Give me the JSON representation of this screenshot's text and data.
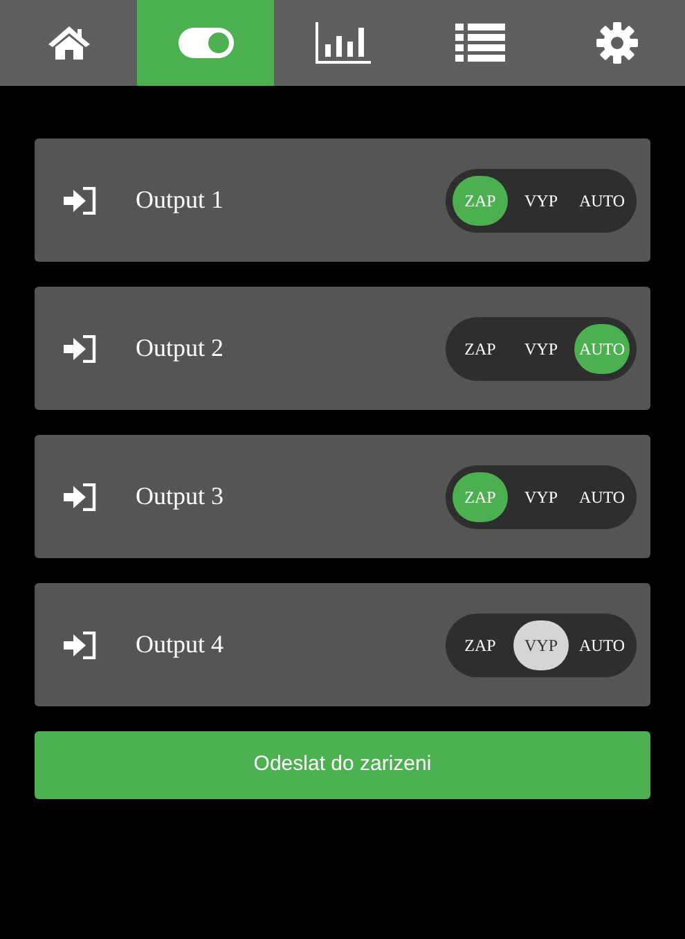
{
  "nav": {
    "tabs": [
      {
        "kind": "home",
        "selected": false
      },
      {
        "kind": "toggle",
        "selected": true
      },
      {
        "kind": "chart",
        "selected": false
      },
      {
        "kind": "list",
        "selected": false
      },
      {
        "kind": "settings",
        "selected": false
      }
    ]
  },
  "outputs": [
    {
      "name": "Output 1",
      "options": [
        {
          "label": "ZAP",
          "selected": true,
          "color": "#4caf50"
        },
        {
          "label": "VYP",
          "selected": false
        },
        {
          "label": "AUTO",
          "selected": false
        }
      ]
    },
    {
      "name": "Output 2",
      "options": [
        {
          "label": "ZAP",
          "selected": false
        },
        {
          "label": "VYP",
          "selected": false
        },
        {
          "label": "AUTO",
          "selected": true,
          "color": "#4caf50"
        }
      ]
    },
    {
      "name": "Output 3",
      "options": [
        {
          "label": "ZAP",
          "selected": true,
          "color": "#4caf50"
        },
        {
          "label": "VYP",
          "selected": false
        },
        {
          "label": "AUTO",
          "selected": false
        }
      ]
    },
    {
      "name": "Output 4",
      "options": [
        {
          "label": "ZAP",
          "selected": false
        },
        {
          "label": "VYP",
          "selected": true,
          "color": "#d5d5d5"
        },
        {
          "label": "AUTO",
          "selected": false
        }
      ]
    }
  ],
  "submit_button": "Odeslat do zarizeni"
}
